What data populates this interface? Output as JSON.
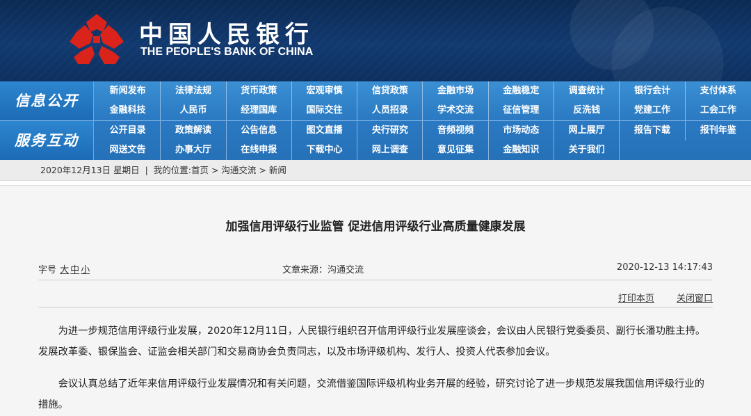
{
  "banner": {
    "logo_cn": "中国人民银行",
    "logo_en": "THE PEOPLE'S BANK OF CHINA",
    "logo_icon": "pboc-emblem-icon",
    "colors": {
      "banner_bg": "#123a70",
      "logo_red": "#d9231b"
    }
  },
  "nav": {
    "colors": {
      "bar": "#2a79c2",
      "head": "#1c6bb6"
    },
    "section1": {
      "title": "信息公开",
      "items": [
        "新闻发布",
        "法律法规",
        "货币政策",
        "宏观审慎",
        "信贷政策",
        "金融市场",
        "金融稳定",
        "调查统计",
        "银行会计",
        "支付体系",
        "金融科技",
        "人民币",
        "经理国库",
        "国际交往",
        "人员招录",
        "学术交流",
        "征信管理",
        "反洗钱",
        "党建工作",
        "工会工作"
      ]
    },
    "section2": {
      "title": "服务互动",
      "items": [
        "公开目录",
        "政策解读",
        "公告信息",
        "图文直播",
        "央行研究",
        "音频视频",
        "市场动态",
        "网上展厅",
        "报告下载",
        "报刊年鉴",
        "网送文告",
        "办事大厅",
        "在线申报",
        "下载中心",
        "网上调查",
        "意见征集",
        "金融知识",
        "关于我们"
      ]
    }
  },
  "breadcrumb": {
    "date": "2020年12月13日 星期日",
    "separator": "|",
    "location_label": "我的位置:",
    "path": "首页 > 沟通交流 > 新闻"
  },
  "article": {
    "title": "加强信用评级行业监管 促进信用评级行业高质量健康发展",
    "font_size_label": "字号",
    "font_size_options": [
      "大",
      "中",
      "小"
    ],
    "source": "文章来源：沟通交流",
    "datetime": "2020-12-13 14:17:43",
    "print_label": "打印本页",
    "close_label": "关闭窗口",
    "paragraphs": [
      "为进一步规范信用评级行业发展，2020年12月11日，人民银行组织召开信用评级行业发展座谈会，会议由人民银行党委委员、副行长潘功胜主持。发展改革委、银保监会、证监会相关部门和交易商协会负责同志，以及市场评级机构、发行人、投资人代表参加会议。",
      "会议认真总结了近年来信用评级行业发展情况和有关问题，交流借鉴国际评级机构业务开展的经验，研究讨论了进一步规范发展我国信用评级行业的措施。"
    ]
  }
}
